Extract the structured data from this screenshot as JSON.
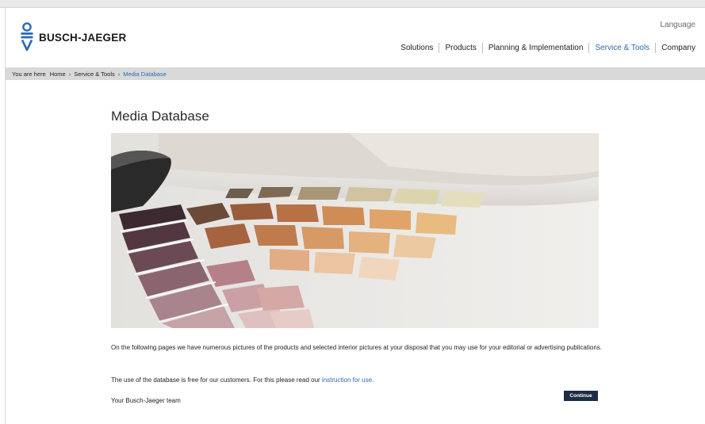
{
  "header": {
    "brand_name": "BUSCH-JAEGER",
    "language_label": "Language",
    "nav": [
      {
        "label": "Solutions"
      },
      {
        "label": "Products"
      },
      {
        "label": "Planning & Implementation"
      },
      {
        "label": "Service & Tools",
        "active": true
      },
      {
        "label": "Company"
      }
    ]
  },
  "breadcrumb": {
    "prefix": "You are here",
    "items": [
      "Home",
      "Service & Tools"
    ],
    "current": "Media Database"
  },
  "main": {
    "title": "Media Database",
    "paragraph_1": "On the following pages we have numerous pictures of the products and selected interior pictures at your disposal that you may use for your editorial or advertising publications.",
    "paragraph_2_text": "The use of the database is free for our customers. For this please read our",
    "paragraph_2_link": "instruction for use.",
    "signoff": "Your Busch-Jaeger team",
    "continue_label": "Continue"
  },
  "colors": {
    "brand_blue": "#2c6ab3",
    "active_nav": "#2c6ab3",
    "button_bg": "#1f2d44",
    "breadcrumb_bg": "#d9d9d9"
  }
}
